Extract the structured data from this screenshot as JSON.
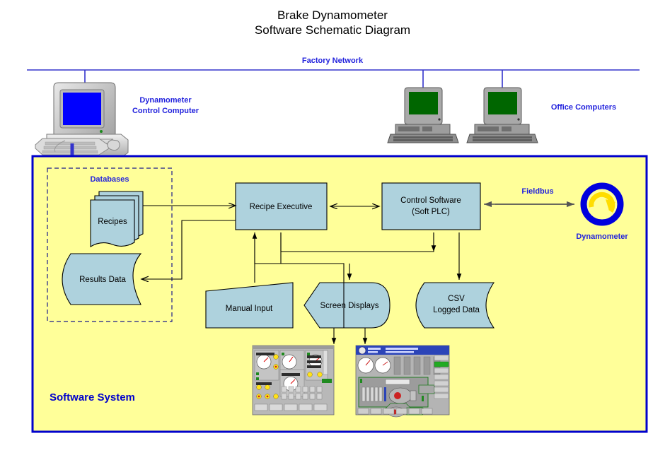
{
  "title": {
    "line1": "Brake Dynamometer",
    "line2": "Software Schematic Diagram"
  },
  "network": {
    "label": "Factory Network"
  },
  "computers": {
    "control": {
      "label_line1": "Dynamometer",
      "label_line2": "Control Computer",
      "screen_color": "#0000ff"
    },
    "office": {
      "label": "Office Computers",
      "screen_color": "#006600",
      "count": 2
    }
  },
  "system": {
    "label": "Software System",
    "fill": "#ffff99",
    "border": "#0000cc"
  },
  "databases": {
    "group_label": "Databases",
    "recipes": "Recipes",
    "results": "Results Data"
  },
  "blocks": {
    "recipe_executive": "Recipe Executive",
    "control_software_line1": "Control Software",
    "control_software_line2": "(Soft PLC)",
    "manual_input": "Manual Input",
    "screen_displays": "Screen Displays",
    "csv_line1": "CSV",
    "csv_line2": "Logged Data"
  },
  "fieldbus": {
    "label": "Fieldbus",
    "device_label": "Dynamometer",
    "ring_color": "#0000dd",
    "arrow_color": "#ffdd00"
  },
  "screenshots": {
    "panel_hmi": "operator-panel-screenshot",
    "mimic_hmi": "configuration-display-screenshot",
    "mimic_header_line1": "BRAKE DYNAMOMETER",
    "mimic_header_line2": "CONFIGURATION DISPLAY",
    "mimic_logo": "SAN MARCO"
  },
  "colors": {
    "shape_fill": "#aed2dd",
    "line": "#000000",
    "blue_text": "#2222dd"
  }
}
